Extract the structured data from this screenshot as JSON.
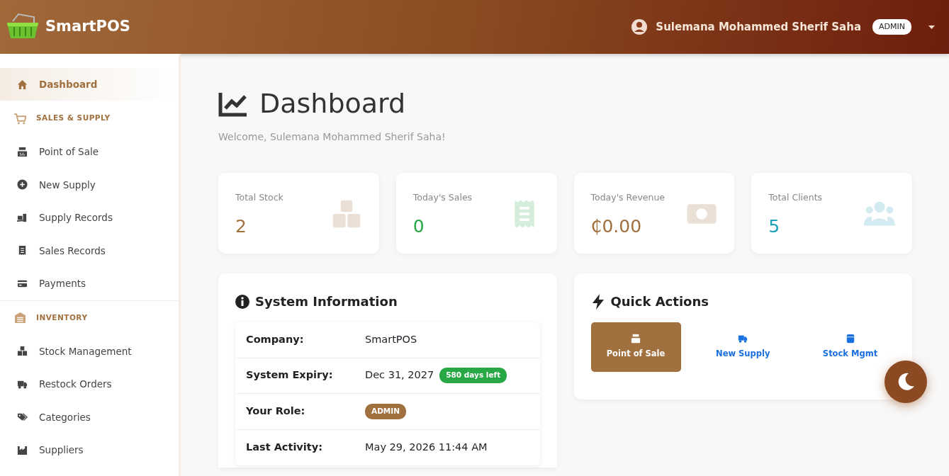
{
  "brand": "SmartPOS",
  "user": {
    "name": "Sulemana Mohammed Sherif Saha",
    "role": "ADMIN"
  },
  "sidebar": {
    "items": [
      {
        "kind": "link",
        "label": "Dashboard",
        "selected": true
      },
      {
        "kind": "section",
        "label": "SALES & SUPPLY"
      },
      {
        "kind": "link",
        "label": "Point of Sale",
        "selected": false
      },
      {
        "kind": "link",
        "label": "New Supply",
        "selected": false
      },
      {
        "kind": "link",
        "label": "Supply Records",
        "selected": false
      },
      {
        "kind": "link",
        "label": "Sales Records",
        "selected": false
      },
      {
        "kind": "link",
        "label": "Payments",
        "selected": false
      },
      {
        "kind": "section",
        "label": "INVENTORY"
      },
      {
        "kind": "link",
        "label": "Stock Management",
        "selected": false
      },
      {
        "kind": "link",
        "label": "Restock Orders",
        "selected": false
      },
      {
        "kind": "link",
        "label": "Categories",
        "selected": false
      },
      {
        "kind": "link",
        "label": "Suppliers",
        "selected": false
      }
    ]
  },
  "page": {
    "title": "Dashboard",
    "welcome": "Welcome, Sulemana Mohammed Sherif Saha!"
  },
  "stats": [
    {
      "label": "Total Stock",
      "value": "2",
      "color": "#a0703f"
    },
    {
      "label": "Today's Sales",
      "value": "0",
      "color": "#28a745"
    },
    {
      "label": "Today's Revenue",
      "value": "₵0.00",
      "color": "#a0703f"
    },
    {
      "label": "Total Clients",
      "value": "5",
      "color": "#17a2b8"
    }
  ],
  "system_info": {
    "title": "System Information",
    "rows": [
      {
        "label": "Company:",
        "value": "SmartPOS"
      },
      {
        "label": "System Expiry:",
        "value": "Dec 31, 2027",
        "badge": "580 days left"
      },
      {
        "label": "Your Role:",
        "role_badge": "ADMIN"
      },
      {
        "label": "Last Activity:",
        "value": "May 29, 2026 11:44 AM"
      }
    ]
  },
  "quick_actions": {
    "title": "Quick Actions",
    "actions": [
      {
        "label": "Point of Sale",
        "selected": true
      },
      {
        "label": "New Supply",
        "selected": false
      },
      {
        "label": "Stock Mgmt",
        "selected": false
      }
    ]
  }
}
